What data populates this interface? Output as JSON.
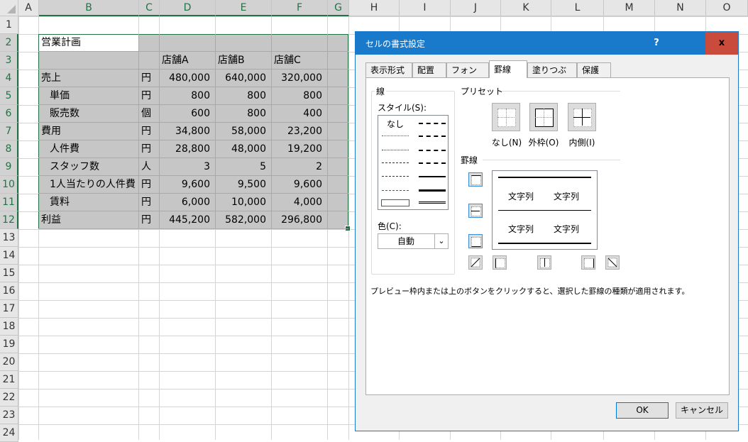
{
  "columns": [
    "A",
    "B",
    "C",
    "D",
    "E",
    "F",
    "G",
    "H",
    "I",
    "J",
    "K",
    "L",
    "M",
    "N",
    "O"
  ],
  "rows": [
    "1",
    "2",
    "3",
    "4",
    "5",
    "6",
    "7",
    "8",
    "9",
    "10",
    "11",
    "12",
    "13",
    "14",
    "15",
    "16",
    "17",
    "18",
    "19",
    "20",
    "21",
    "22",
    "23",
    "24"
  ],
  "table": {
    "title": "営業計画",
    "headers": [
      "店舗A",
      "店舗B",
      "店舗C"
    ],
    "data": [
      {
        "label": "売上",
        "unit": "円",
        "a": "480,000",
        "b": "640,000",
        "c": "320,000"
      },
      {
        "label": "単価",
        "unit": "円",
        "a": "800",
        "b": "800",
        "c": "800"
      },
      {
        "label": "販売数",
        "unit": "個",
        "a": "600",
        "b": "800",
        "c": "400"
      },
      {
        "label": "費用",
        "unit": "円",
        "a": "34,800",
        "b": "58,000",
        "c": "23,200"
      },
      {
        "label": "人件費",
        "unit": "円",
        "a": "28,800",
        "b": "48,000",
        "c": "19,200"
      },
      {
        "label": "スタッフ数",
        "unit": "人",
        "a": "3",
        "b": "5",
        "c": "2"
      },
      {
        "label": "1人当たりの人件費",
        "unit": "円",
        "a": "9,600",
        "b": "9,500",
        "c": "9,600"
      },
      {
        "label": "賃料",
        "unit": "円",
        "a": "6,000",
        "b": "10,000",
        "c": "4,000"
      },
      {
        "label": "利益",
        "unit": "円",
        "a": "445,200",
        "b": "582,000",
        "c": "296,800"
      }
    ]
  },
  "dialog": {
    "title": "セルの書式設定",
    "help": "?",
    "close": "x",
    "tabs": [
      "表示形式",
      "配置",
      "フォント",
      "罫線",
      "塗りつぶし",
      "保護"
    ],
    "line_group": "線",
    "style_label": "スタイル(S):",
    "style_none": "なし",
    "color_label": "色(C):",
    "color_value": "自動",
    "preset_group": "プリセット",
    "presets": [
      "なし(N)",
      "外枠(O)",
      "内側(I)"
    ],
    "border_group": "罫線",
    "preview_text": "文字列",
    "hint": "プレビュー枠内または上のボタンをクリックすると、選択した罫線の種類が適用されます。",
    "ok": "OK",
    "cancel": "キャンセル"
  },
  "colors": {
    "accent": "#217346",
    "titlebar": "#1979ca",
    "close": "#c84b3c",
    "selection": "#c6c6c6"
  }
}
